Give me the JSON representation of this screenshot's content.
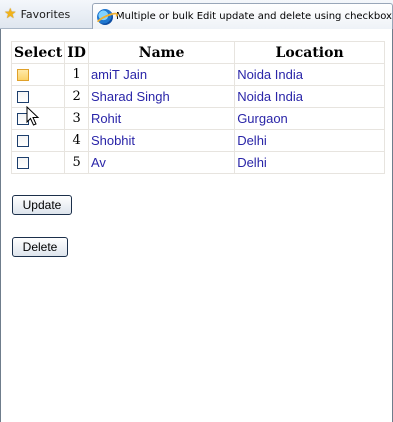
{
  "browser": {
    "favorites_label": "Favorites",
    "tab_title": "Multiple or bulk Edit update and delete using checkbox..."
  },
  "grid": {
    "headers": [
      "Select",
      "ID",
      "Name",
      "Location"
    ],
    "rows": [
      {
        "id": "1",
        "name": "amiT Jain",
        "location": "Noida India"
      },
      {
        "id": "2",
        "name": "Sharad Singh",
        "location": "Noida India"
      },
      {
        "id": "3",
        "name": "Rohit",
        "location": "Gurgaon"
      },
      {
        "id": "4",
        "name": "Shobhit",
        "location": "Delhi"
      },
      {
        "id": "5",
        "name": "Av",
        "location": "Delhi"
      }
    ]
  },
  "buttons": {
    "update_label": "Update",
    "delete_label": "Delete"
  },
  "colors": {
    "link": "#2a25a8",
    "checkbox_hover": "#fbd36a"
  },
  "icons": [
    "star-icon",
    "ie-icon",
    "mouse-cursor-icon"
  ]
}
